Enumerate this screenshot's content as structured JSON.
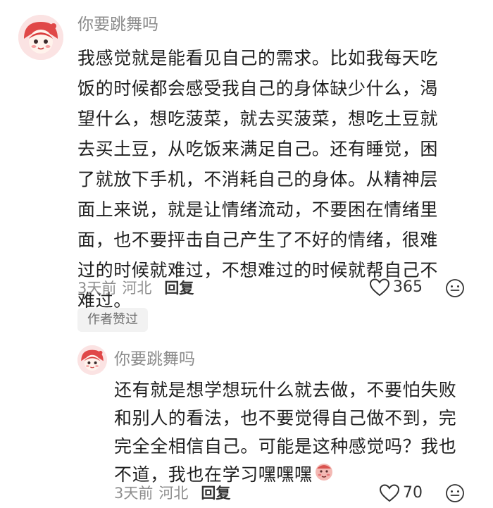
{
  "main_comment": {
    "username": "你要跳舞吗",
    "content": "我感觉就是能看见自己的需求。比如我每天吃\n饭的时候都会感受我自己的身体缺少什么，渴\n望什么，想吃菠菜，就去买菠菜，想吃土豆就\n去买土豆，从吃饭来满足自己。还有睡觉，困\n了就放下手机，不消耗自己的身体。从精神层\n面上来说，就是让情绪流动，不要困在情绪里\n面，也不要抨击自己产生了不好的情绪，很难\n过的时候就难过，不想难过的时候就帮自己不\n难过。",
    "time": "3天前",
    "location": "河北",
    "reply_label": "回复",
    "likes": "365",
    "author_badge": "作者赞过"
  },
  "reply_comment": {
    "username": "你要跳舞吗",
    "content": "还有就是想学想玩什么就去做，不要怕失败\n和别人的看法，也不要觉得自己做不到，完\n完全全相信自己。可能是这种感觉吗？我也\n不道，我也在学习嘿嘿嘿",
    "time": "3天前",
    "location": "河北",
    "reply_label": "回复",
    "likes": "70"
  },
  "icons": {
    "like": "heart-outline-icon",
    "emoji": "smiley-face-icon",
    "inline": "blushing-face-sticker"
  },
  "colors": {
    "username": "#8b8b8b",
    "meta": "#8f8f8f",
    "badge_bg": "#f2f2f2"
  }
}
